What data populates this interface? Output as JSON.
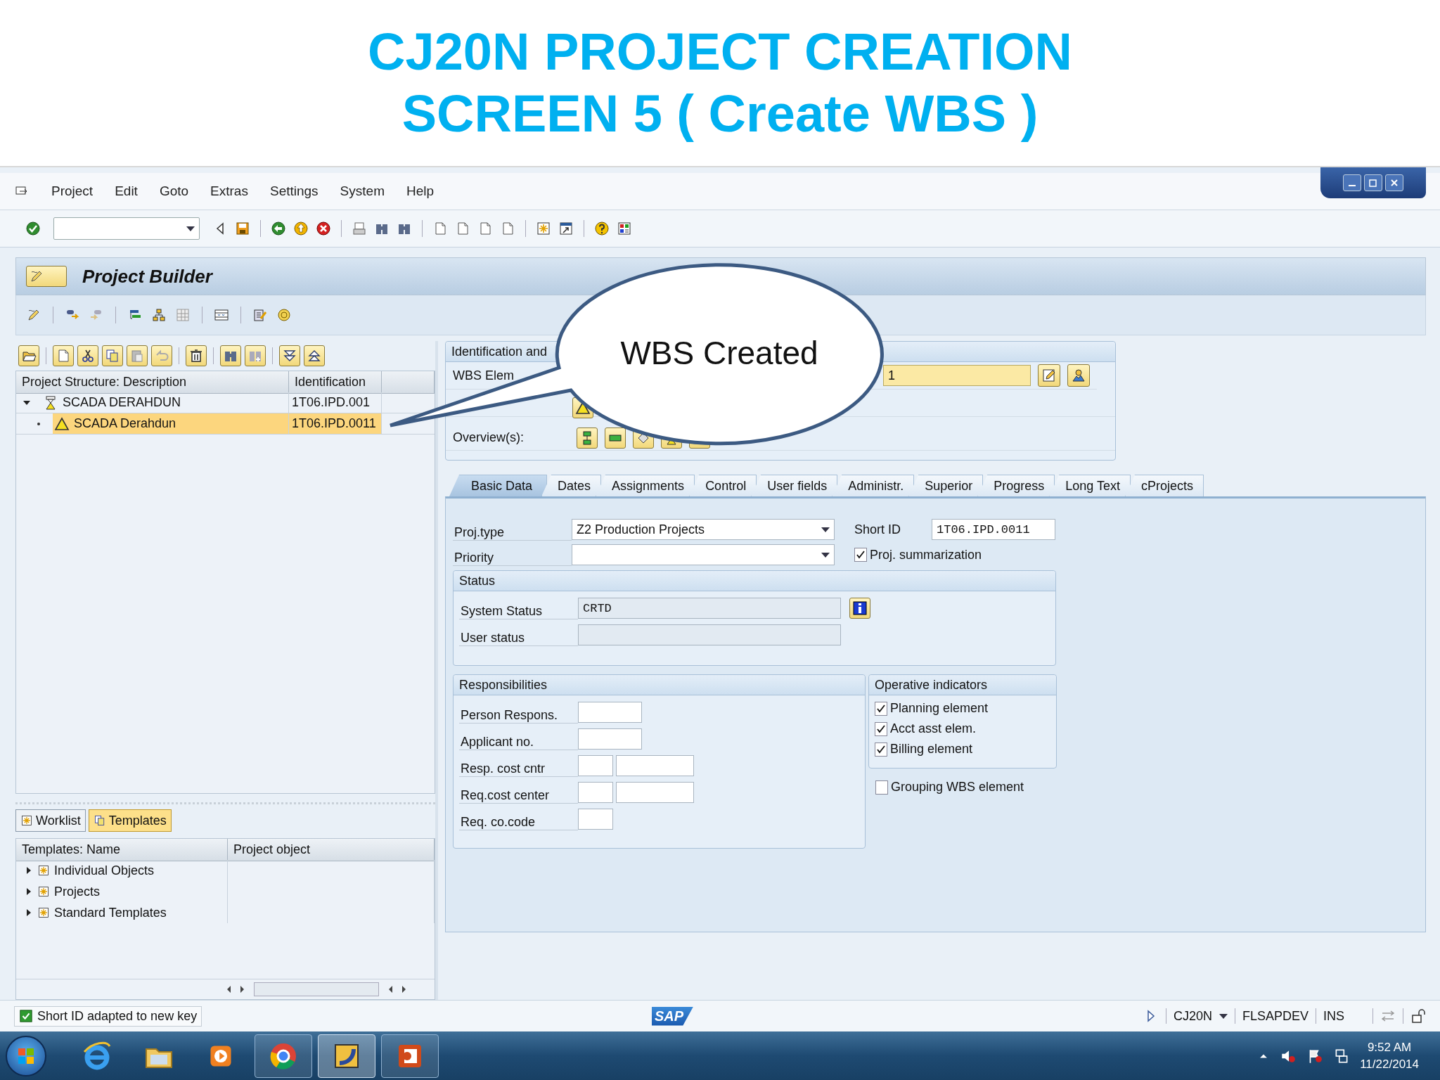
{
  "slide_title": [
    "CJ20N PROJECT CREATION",
    "SCREEN 5 ( Create WBS )"
  ],
  "callout": {
    "text": "WBS Created"
  },
  "menu": [
    "Project",
    "Edit",
    "Goto",
    "Extras",
    "Settings",
    "System",
    "Help"
  ],
  "panel_title": "Project Builder",
  "tree": {
    "columns": [
      "Project Structure: Description",
      "Identification"
    ],
    "rows": [
      {
        "kind": "project",
        "description": "SCADA DERAHDUN",
        "identification": "1T06.IPD.001",
        "expanded": true,
        "selected": false,
        "children": [
          {
            "kind": "wbs",
            "description": "SCADA Derahdun",
            "identification": "1T06.IPD.0011",
            "selected": true
          }
        ]
      }
    ]
  },
  "lower_tabs": [
    {
      "label": "Worklist",
      "selected": false
    },
    {
      "label": "Templates",
      "selected": true
    }
  ],
  "templates": {
    "columns": [
      "Templates: Name",
      "Project object"
    ],
    "rows": [
      {
        "name": "Individual Objects",
        "expanded": false
      },
      {
        "name": "Projects",
        "expanded": false
      },
      {
        "name": "Standard Templates",
        "expanded": false
      }
    ]
  },
  "identification": {
    "title": "Identification and",
    "wbs_label": "WBS Elem",
    "wbs_value": "1",
    "overview_label": "Overview(s):"
  },
  "tabs": [
    {
      "label": "Basic Data",
      "selected": true
    },
    {
      "label": "Dates",
      "selected": false
    },
    {
      "label": "Assignments",
      "selected": false
    },
    {
      "label": "Control",
      "selected": false
    },
    {
      "label": "User fields",
      "selected": false
    },
    {
      "label": "Administr.",
      "selected": false
    },
    {
      "label": "Superior",
      "selected": false
    },
    {
      "label": "Progress",
      "selected": false
    },
    {
      "label": "Long Text",
      "selected": false
    },
    {
      "label": "cProjects",
      "selected": false
    }
  ],
  "basic_data": {
    "proj_type_label": "Proj.type",
    "proj_type_value": "Z2 Production Projects",
    "priority_label": "Priority",
    "short_id_label": "Short ID",
    "short_id_value": "1T06.IPD.0011",
    "summarization": {
      "label": "Proj. summarization",
      "checked": true
    }
  },
  "status": {
    "title": "Status",
    "fields": [
      {
        "label": "System Status",
        "value": "CRTD"
      },
      {
        "label": "User status"
      }
    ]
  },
  "responsibilities": {
    "title": "Responsibilities",
    "rows": [
      {
        "label": "Person Respons.",
        "kind": "wide"
      },
      {
        "label": "Applicant no.",
        "kind": "wide"
      },
      {
        "label": "Resp. cost cntr",
        "kind": "pair"
      },
      {
        "label": "Req.cost center",
        "kind": "pair"
      },
      {
        "label": "Req. co.code",
        "kind": "short"
      }
    ]
  },
  "operative_indicators": {
    "title": "Operative indicators",
    "items": [
      {
        "label": "Planning element",
        "checked": true
      },
      {
        "label": "Acct asst elem.",
        "checked": true
      },
      {
        "label": "Billing element",
        "checked": true
      }
    ]
  },
  "grouping": {
    "label": "Grouping WBS element",
    "checked": false
  },
  "status_bar": {
    "message": "Short ID adapted to new key",
    "logo": "SAP",
    "transaction": "CJ20N",
    "system": "FLSAPDEV",
    "mode": "INS"
  },
  "taskbar": {
    "time": "9:52 AM",
    "date": "11/22/2014"
  }
}
